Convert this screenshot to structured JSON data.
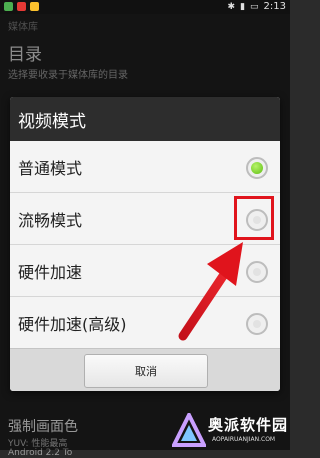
{
  "status_bar": {
    "time": "2:13"
  },
  "background": {
    "action_title": "媒体库",
    "title": "目录",
    "subtitle": "选择要收录于媒体库的目录",
    "strong_text": "强制画面色",
    "small1": "YUV: 性能最高",
    "small2": "Android 2.2 To"
  },
  "dialog": {
    "title": "视频模式",
    "options": [
      {
        "label": "普通模式",
        "selected": true
      },
      {
        "label": "流畅模式",
        "selected": false
      },
      {
        "label": "硬件加速",
        "selected": false
      },
      {
        "label": "硬件加速(高级)",
        "selected": false
      }
    ],
    "cancel_label": "取消"
  },
  "watermark": {
    "text": "奥派软件园",
    "sub": "AOPAIRUANJIAN.COM"
  },
  "colors": {
    "accent_red": "#e0141c",
    "radio_green": "#5fbf13"
  }
}
